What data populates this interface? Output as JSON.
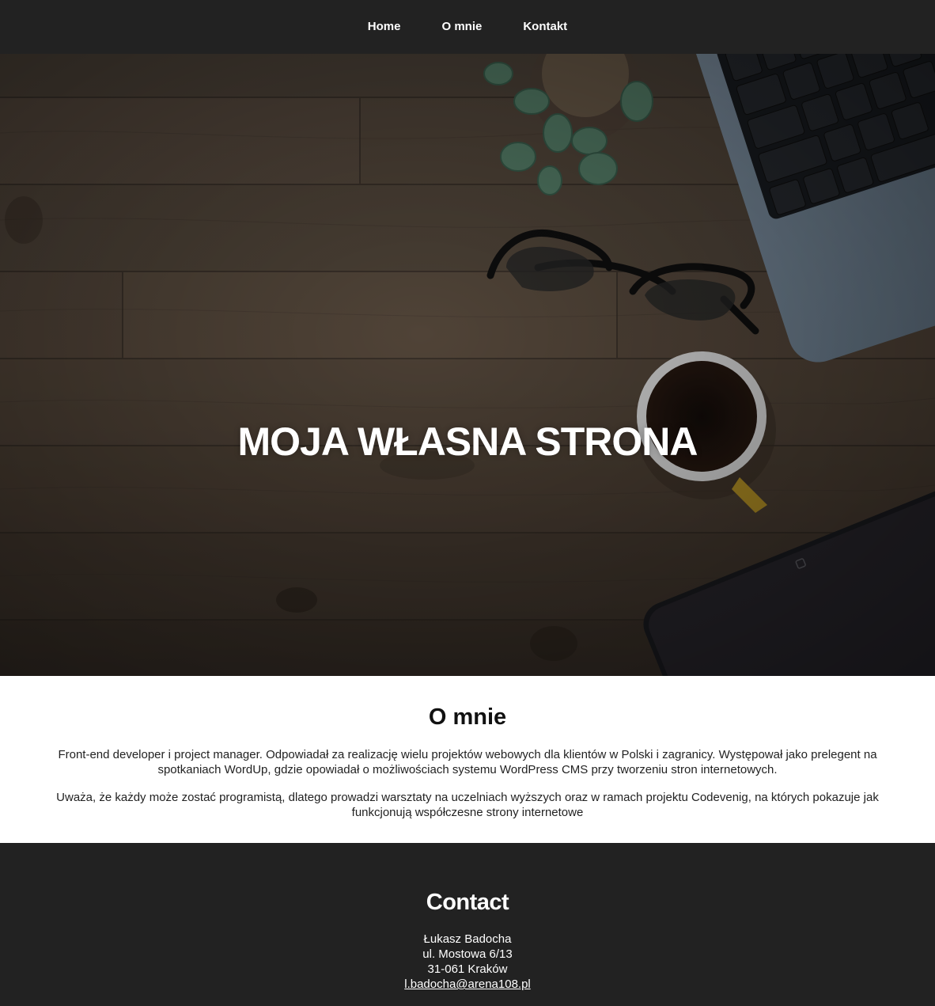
{
  "nav": {
    "items": [
      {
        "label": "Home"
      },
      {
        "label": "O mnie"
      },
      {
        "label": "Kontakt"
      }
    ]
  },
  "hero": {
    "title": "MOJA WŁASNA STRONA"
  },
  "about": {
    "heading": "O mnie",
    "paragraph_1": "Front-end developer i project manager. Odpowiadał za realizację wielu projektów webowych dla klientów w Polski i zagranicy. Występował jako prelegent na spotkaniach WordUp, gdzie opowiadał o możliwościach systemu WordPress CMS przy tworzeniu stron internetowych.",
    "paragraph_2": "Uważa, że każdy może zostać programistą, dlatego prowadzi warsztaty na uczelniach wyższych oraz w ramach projektu Codevenig, na których pokazuje jak funkcjonują współczesne strony internetowe"
  },
  "contact": {
    "heading": "Contact",
    "name": "Łukasz Badocha",
    "street": "ul. Mostowa 6/13",
    "city": "31-061 Kraków",
    "email": "l.badocha@arena108.pl"
  },
  "colors": {
    "nav_bg": "#222222",
    "footer_bg": "#222222",
    "text_light": "#ffffff",
    "text_dark": "#222222"
  }
}
